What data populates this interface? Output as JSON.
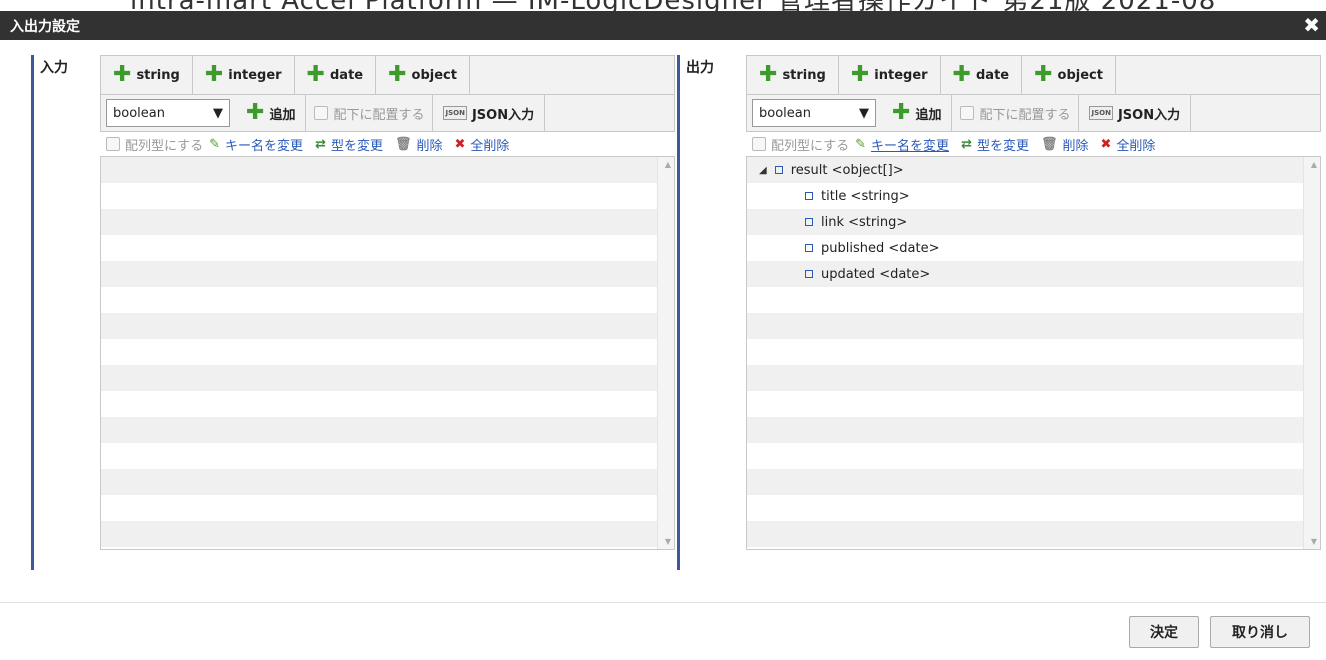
{
  "background_title": "intra-mart Accel Platform — IM-LogicDesigner 管理者操作ガイド 第21版 2021-08",
  "dialog": {
    "title": "入出力設定",
    "close_icon": "close-icon"
  },
  "input_panel": {
    "label": "入力",
    "type_tabs": [
      "string",
      "integer",
      "date",
      "object"
    ],
    "type_select": "boolean",
    "add_label": "追加",
    "place_under_label": "配下に配置する",
    "json_label": "JSON入力",
    "array_label": "配列型にする",
    "rename_label": "キー名を変更",
    "change_type_label": "型を変更",
    "delete_label": "削除",
    "delete_all_label": "全削除",
    "tree": []
  },
  "output_panel": {
    "label": "出力",
    "type_tabs": [
      "string",
      "integer",
      "date",
      "object"
    ],
    "type_select": "boolean",
    "add_label": "追加",
    "place_under_label": "配下に配置する",
    "json_label": "JSON入力",
    "array_label": "配列型にする",
    "rename_label": "キー名を変更",
    "change_type_label": "型を変更",
    "delete_label": "削除",
    "delete_all_label": "全削除",
    "tree": [
      {
        "text": "result <object[]>",
        "level": 0,
        "expanded": true
      },
      {
        "text": "title <string>",
        "level": 1
      },
      {
        "text": "link <string>",
        "level": 1
      },
      {
        "text": "published <date>",
        "level": 1
      },
      {
        "text": "updated <date>",
        "level": 1
      }
    ]
  },
  "footer": {
    "ok_label": "決定",
    "cancel_label": "取り消し"
  },
  "colors": {
    "titlebar": "#323232",
    "accent_border": "#3a5a99",
    "plus": "#3c9b2b",
    "link": "#2a5ab8"
  }
}
